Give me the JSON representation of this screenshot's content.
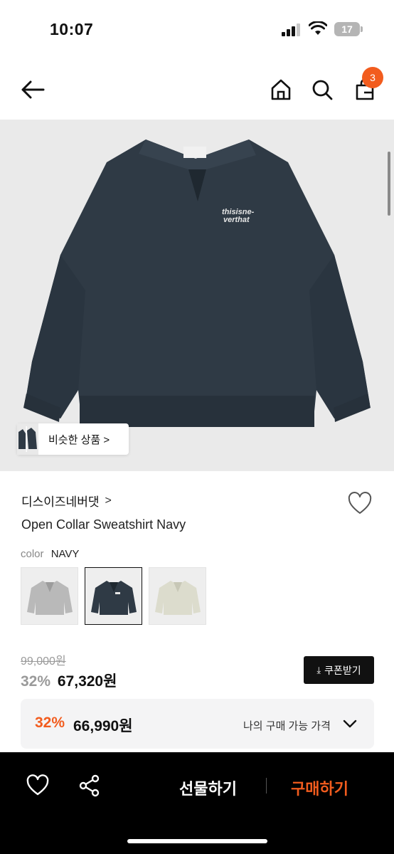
{
  "status_bar": {
    "time": "10:07",
    "battery": "17"
  },
  "nav": {
    "cart_count": "3",
    "icons": [
      "back-arrow-icon",
      "home-icon",
      "search-icon",
      "cart-icon"
    ]
  },
  "hero": {
    "similar_label": "비슷한 상품 >"
  },
  "product": {
    "brand": "디스이즈네버댓",
    "brand_chevron": ">",
    "name": "Open Collar Sweatshirt Navy",
    "color_label": "color",
    "color_value": "NAVY",
    "swatches": [
      {
        "color": "#b9b9b9"
      },
      {
        "color": "#2f3a45"
      },
      {
        "color": "#dcdccd"
      }
    ],
    "original_price": "99,000원",
    "discount": "32%",
    "sale_price": "67,320원",
    "coupon_label": "쿠폰받기",
    "mypay": {
      "discount": "32%",
      "price": "66,990원",
      "label": "나의 구매 가능 가격"
    }
  },
  "bottom_bar": {
    "gift_label": "선물하기",
    "buy_label": "구매하기"
  },
  "colors": {
    "accent": "#f25c1e",
    "navy": "#2f3a45"
  }
}
